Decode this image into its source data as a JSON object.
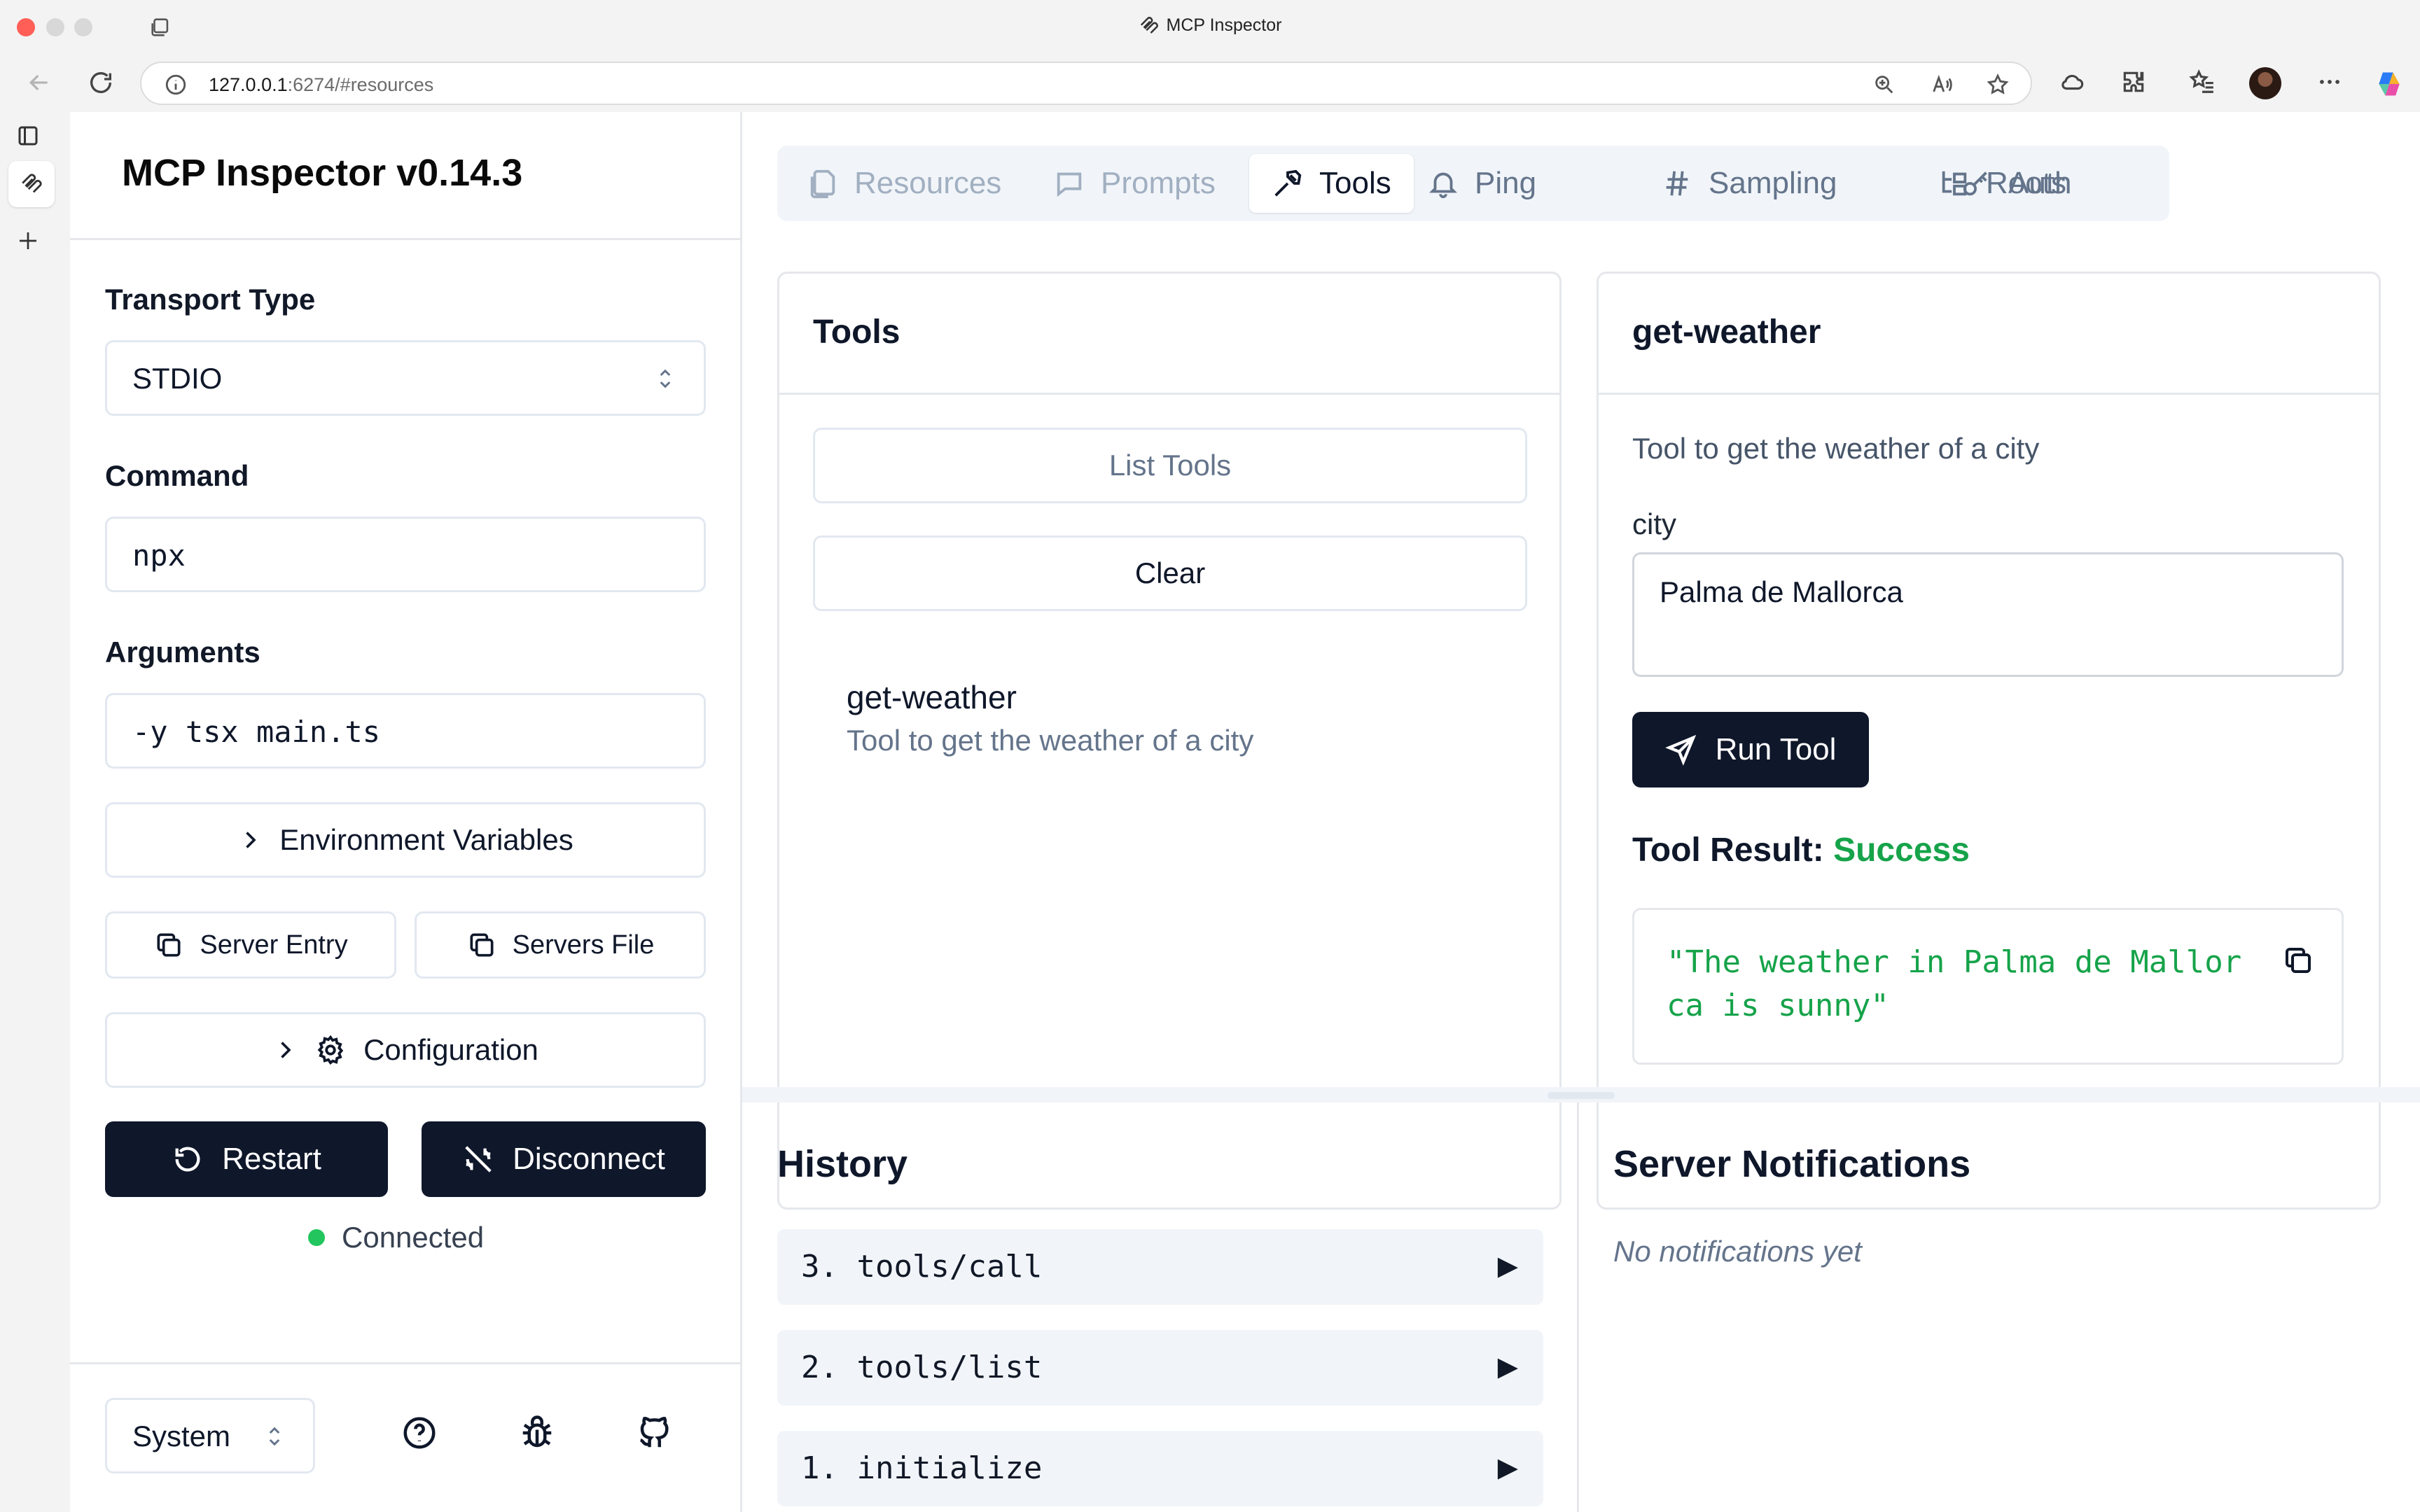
{
  "browser": {
    "window_title": "MCP Inspector",
    "url_host": "127.0.0.1",
    "url_rest": ":6274/#resources"
  },
  "sidebar": {
    "title": "MCP Inspector v0.14.3",
    "transport_label": "Transport Type",
    "transport_value": "STDIO",
    "command_label": "Command",
    "command_value": "npx",
    "arguments_label": "Arguments",
    "arguments_value": "-y tsx main.ts",
    "env_vars_label": "Environment Variables",
    "server_entry_label": "Server Entry",
    "servers_file_label": "Servers File",
    "configuration_label": "Configuration",
    "restart_label": "Restart",
    "disconnect_label": "Disconnect",
    "status_text": "Connected",
    "status_color": "#22c55e",
    "theme_value": "System"
  },
  "tabs": [
    {
      "label": "Resources",
      "icon": "files-icon",
      "state": "disabled"
    },
    {
      "label": "Prompts",
      "icon": "message-icon",
      "state": "disabled"
    },
    {
      "label": "Tools",
      "icon": "hammer-icon",
      "state": "active"
    },
    {
      "label": "Ping",
      "icon": "bell-icon",
      "state": "normal"
    },
    {
      "label": "Sampling",
      "icon": "hash-icon",
      "state": "normal"
    },
    {
      "label": "Roots",
      "icon": "folder-tree-icon",
      "state": "normal"
    },
    {
      "label": "Auth",
      "icon": "key-icon",
      "state": "normal"
    }
  ],
  "tools_panel": {
    "title": "Tools",
    "list_button": "List Tools",
    "clear_button": "Clear",
    "items": [
      {
        "name": "get-weather",
        "description": "Tool to get the weather of a city"
      }
    ]
  },
  "tool_detail": {
    "title": "get-weather",
    "description": "Tool to get the weather of a city",
    "param_label": "city",
    "param_value": "Palma de Mallorca",
    "run_button": "Run Tool",
    "result_label": "Tool Result:",
    "result_status": "Success",
    "result_status_color": "#16a34a",
    "result_text": "\"The weather in Palma de Mallorca is sunny\""
  },
  "history": {
    "title": "History",
    "items": [
      {
        "label": "3. tools/call"
      },
      {
        "label": "2. tools/list"
      },
      {
        "label": "1. initialize"
      }
    ],
    "expand_glyph": "▶"
  },
  "notifications": {
    "title": "Server Notifications",
    "empty_text": "No notifications yet"
  }
}
